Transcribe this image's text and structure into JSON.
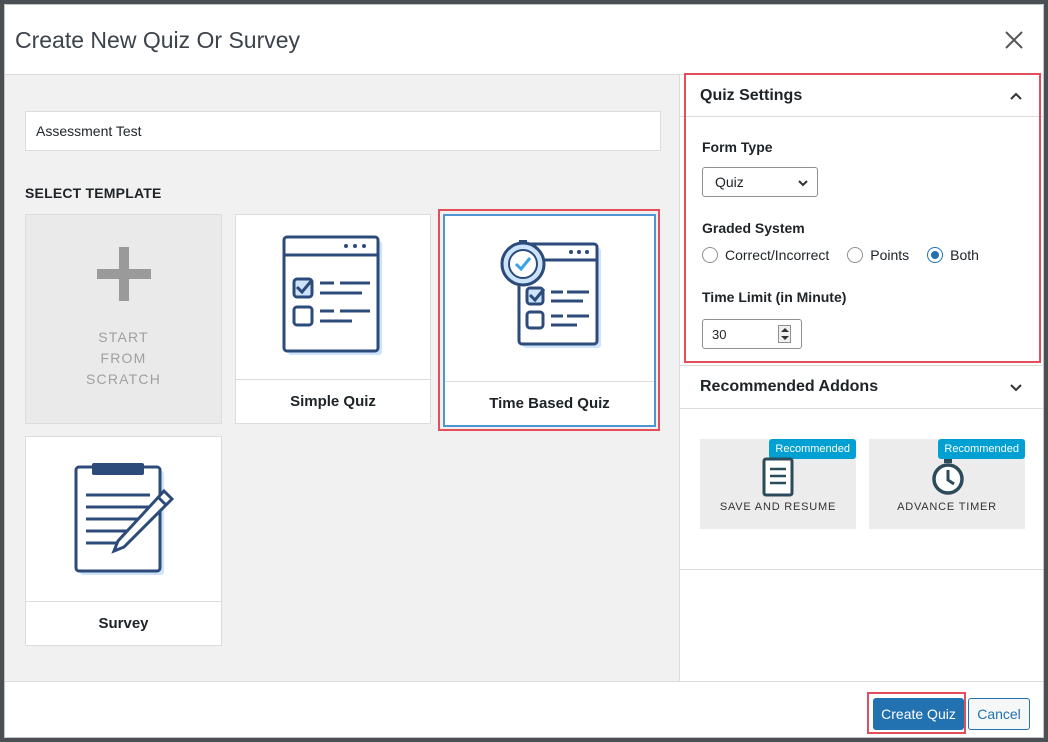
{
  "modal": {
    "title": "Create New Quiz Or Survey",
    "close_icon": "close-icon"
  },
  "left": {
    "quiz_name_value": "Assessment Test",
    "select_template_label": "SELECT TEMPLATE",
    "templates": [
      {
        "label": "START\nFROM\nSCRATCH",
        "icon": "plus-icon"
      },
      {
        "label": "Simple Quiz",
        "icon": "quiz-form-icon"
      },
      {
        "label": "Time Based Quiz",
        "icon": "timed-quiz-icon",
        "selected": true
      },
      {
        "label": "Survey",
        "icon": "clipboard-pen-icon"
      }
    ]
  },
  "settings": {
    "title": "Quiz Settings",
    "form_type_label": "Form Type",
    "form_type_value": "Quiz",
    "graded_label": "Graded System",
    "graded_options": [
      "Correct/Incorrect",
      "Points",
      "Both"
    ],
    "graded_selected": "Both",
    "time_limit_label": "Time Limit (in Minute)",
    "time_limit_value": "30"
  },
  "addons": {
    "title": "Recommended Addons",
    "items": [
      {
        "badge": "Recommended",
        "label": "SAVE AND RESUME",
        "icon": "document-icon"
      },
      {
        "badge": "Recommended",
        "label": "ADVANCE TIMER",
        "icon": "clock-icon"
      }
    ]
  },
  "footer": {
    "create_label": "Create Quiz",
    "cancel_label": "Cancel"
  },
  "colors": {
    "primary": "#2271b1",
    "highlight": "#e44d5a",
    "icon_blue": "#2c4b7a",
    "icon_light": "#cde3fb",
    "badge": "#00a0d2"
  }
}
